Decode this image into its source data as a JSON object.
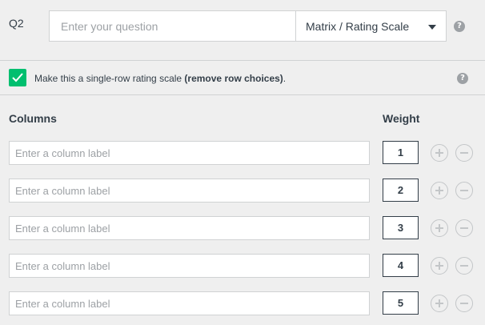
{
  "question": {
    "number": "Q2",
    "placeholder": "Enter your question",
    "type_label": "Matrix / Rating Scale"
  },
  "help_glyph": "?",
  "option": {
    "checked": true,
    "label_prefix": "Make this a single-row rating scale ",
    "label_bold": "(remove row choices)",
    "label_suffix": "."
  },
  "table": {
    "columns_heading": "Columns",
    "weight_heading": "Weight",
    "rows": [
      {
        "placeholder": "Enter a column label",
        "weight": "1"
      },
      {
        "placeholder": "Enter a column label",
        "weight": "2"
      },
      {
        "placeholder": "Enter a column label",
        "weight": "3"
      },
      {
        "placeholder": "Enter a column label",
        "weight": "4"
      },
      {
        "placeholder": "Enter a column label",
        "weight": "5"
      }
    ]
  },
  "colors": {
    "accent": "#00bf6f",
    "text": "#333e48",
    "border": "#d0d2d3",
    "muted": "#9da1a5"
  },
  "icons": [
    "help-icon",
    "chevron-down-icon",
    "checkmark-icon",
    "plus-circle-icon",
    "minus-circle-icon"
  ]
}
